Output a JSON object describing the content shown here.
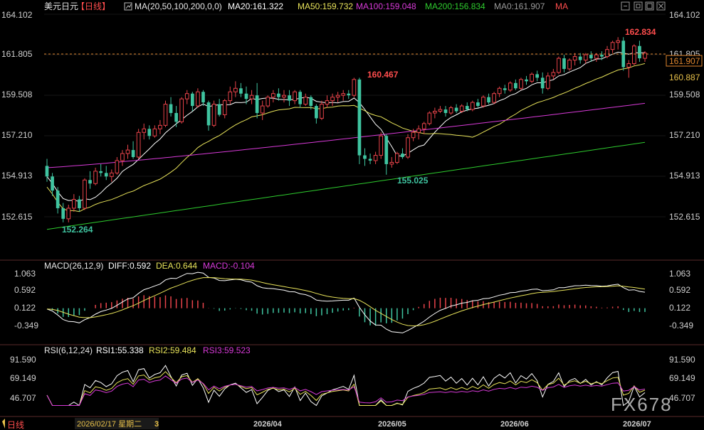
{
  "header": {
    "symbol": "美元日元",
    "period": "【日线】",
    "ma_params": "MA(20,50,100,200,0,0)",
    "ma20": "MA20:161.322",
    "ma50": "MA50:159.732",
    "ma100": "MA100:159.048",
    "ma200": "MA200:156.834",
    "ma0": "MA0:161.907",
    "ma_tag": "MA"
  },
  "macd_header": {
    "params": "MACD(26,12,9)",
    "diff": "DIFF:0.592",
    "dea": "DEA:0.644",
    "macd": "MACD:-0.104"
  },
  "rsi_header": {
    "params": "RSI(6,12,24)",
    "rsi1": "RSI1:55.338",
    "rsi2": "RSI2:59.484",
    "rsi3": "RSI3:59.523"
  },
  "price_axis": {
    "labels_left": [
      "164.102",
      "161.805",
      "159.508",
      "157.210",
      "154.913",
      "152.615"
    ],
    "labels_right": [
      "164.102",
      "161.805",
      "159.508",
      "157.210",
      "154.913",
      "152.615"
    ],
    "values": [
      164.102,
      161.805,
      159.508,
      157.21,
      154.913,
      152.615
    ],
    "current_price": "161.907",
    "low_box": "160.887"
  },
  "annotations": {
    "high1": "160.467",
    "low1": "155.025",
    "low0": "152.264",
    "high2": "162.834"
  },
  "macd_axis": {
    "labels": [
      "1.063",
      "0.592",
      "0.122",
      "-0.349"
    ],
    "values": [
      1.063,
      0.592,
      0.122,
      -0.349
    ]
  },
  "rsi_axis": {
    "labels": [
      "91.590",
      "69.149",
      "46.707"
    ],
    "values": [
      91.59,
      69.149,
      46.707
    ]
  },
  "date_axis": {
    "cursor_date": "2026/02/17 星期二",
    "cursor_tail": "3",
    "ticks": [
      "2026/04",
      "2026/05",
      "2026/06",
      "2026/07"
    ]
  },
  "bottom_tab": "日线",
  "watermark": "FX678",
  "colors": {
    "up": "#e8434a",
    "down": "#3fc4a0",
    "ma20": "#ffffff",
    "ma50": "#e8e35a",
    "ma100": "#d83ad8",
    "ma200": "#2ecc2e",
    "rsi2": "#e8e35a",
    "rsi3": "#d83ad8",
    "label_red": "#ff4d4d",
    "label_green": "#3fc4a0",
    "header_gold": "#e8c14a"
  },
  "chart_data": {
    "type": "candlestick",
    "ohlc": [
      [
        155.5,
        155.9,
        154.6,
        154.9
      ],
      [
        154.9,
        155.1,
        153.8,
        154.1
      ],
      [
        154.1,
        154.3,
        152.8,
        153.1
      ],
      [
        153.1,
        153.4,
        152.3,
        152.5
      ],
      [
        152.5,
        153.3,
        152.3,
        153.1
      ],
      [
        153.1,
        153.9,
        152.9,
        153.6
      ],
      [
        153.6,
        153.8,
        152.9,
        153.1
      ],
      [
        153.1,
        154.8,
        153.0,
        154.7
      ],
      [
        154.7,
        155.2,
        154.2,
        154.5
      ],
      [
        154.5,
        155.4,
        154.4,
        155.2
      ],
      [
        155.2,
        155.6,
        154.9,
        155.1
      ],
      [
        155.1,
        155.5,
        154.7,
        154.9
      ],
      [
        154.9,
        155.3,
        154.6,
        155.1
      ],
      [
        155.1,
        156.0,
        155.0,
        155.8
      ],
      [
        155.8,
        156.4,
        155.5,
        156.2
      ],
      [
        156.2,
        156.7,
        155.9,
        156.4
      ],
      [
        156.4,
        156.9,
        155.9,
        156.0
      ],
      [
        156.0,
        157.6,
        155.9,
        157.4
      ],
      [
        157.4,
        157.9,
        157.0,
        157.6
      ],
      [
        157.6,
        157.8,
        157.0,
        157.2
      ],
      [
        157.2,
        157.8,
        157.1,
        157.6
      ],
      [
        157.6,
        158.1,
        157.3,
        157.8
      ],
      [
        157.8,
        159.2,
        157.7,
        159.0
      ],
      [
        159.0,
        159.4,
        158.3,
        158.5
      ],
      [
        158.5,
        158.9,
        157.7,
        158.0
      ],
      [
        158.0,
        159.4,
        157.9,
        159.3
      ],
      [
        159.3,
        159.8,
        159.0,
        159.6
      ],
      [
        159.6,
        159.7,
        158.6,
        158.9
      ],
      [
        158.9,
        159.9,
        158.8,
        159.7
      ],
      [
        159.7,
        159.8,
        158.9,
        159.1
      ],
      [
        159.1,
        159.2,
        157.5,
        157.8
      ],
      [
        157.8,
        159.2,
        157.7,
        159.0
      ],
      [
        159.0,
        159.3,
        158.3,
        158.4
      ],
      [
        158.4,
        159.3,
        158.2,
        159.2
      ],
      [
        159.2,
        160.0,
        159.0,
        159.7
      ],
      [
        159.7,
        160.3,
        159.4,
        159.9
      ],
      [
        159.9,
        160.2,
        159.4,
        159.6
      ],
      [
        159.6,
        160.0,
        159.0,
        159.3
      ],
      [
        159.3,
        159.8,
        159.0,
        159.5
      ],
      [
        159.5,
        160.2,
        158.2,
        158.5
      ],
      [
        158.5,
        159.2,
        158.1,
        158.9
      ],
      [
        158.9,
        159.5,
        158.8,
        159.4
      ],
      [
        159.4,
        159.8,
        159.1,
        159.6
      ],
      [
        159.6,
        159.9,
        159.2,
        159.4
      ],
      [
        159.4,
        159.8,
        159.1,
        159.5
      ],
      [
        159.5,
        159.8,
        158.9,
        159.2
      ],
      [
        159.2,
        159.8,
        159.0,
        159.7
      ],
      [
        159.7,
        159.8,
        158.8,
        159.0
      ],
      [
        159.0,
        159.6,
        158.9,
        159.4
      ],
      [
        159.4,
        159.5,
        158.7,
        158.9
      ],
      [
        158.9,
        159.0,
        157.9,
        158.2
      ],
      [
        158.2,
        159.2,
        158.1,
        159.0
      ],
      [
        159.0,
        159.5,
        158.8,
        159.2
      ],
      [
        159.2,
        159.6,
        158.9,
        159.4
      ],
      [
        159.4,
        159.7,
        159.1,
        159.5
      ],
      [
        159.5,
        159.8,
        159.2,
        159.6
      ],
      [
        159.6,
        159.8,
        159.3,
        159.5
      ],
      [
        159.5,
        160.5,
        159.4,
        160.4
      ],
      [
        160.4,
        160.5,
        155.6,
        156.1
      ],
      [
        156.1,
        156.5,
        155.5,
        155.9
      ],
      [
        155.9,
        156.2,
        155.6,
        155.8
      ],
      [
        155.8,
        156.3,
        155.6,
        156.1
      ],
      [
        156.1,
        157.4,
        155.9,
        157.2
      ],
      [
        157.2,
        157.3,
        155.0,
        155.6
      ],
      [
        155.6,
        156.0,
        155.4,
        155.7
      ],
      [
        155.7,
        156.3,
        155.6,
        156.2
      ],
      [
        156.2,
        156.5,
        155.9,
        156.0
      ],
      [
        156.0,
        157.3,
        155.9,
        157.1
      ],
      [
        157.1,
        157.6,
        156.9,
        157.4
      ],
      [
        157.4,
        157.8,
        157.0,
        157.6
      ],
      [
        157.6,
        158.0,
        157.3,
        157.9
      ],
      [
        157.9,
        158.6,
        157.8,
        158.5
      ],
      [
        158.5,
        158.8,
        158.2,
        158.6
      ],
      [
        158.6,
        158.9,
        158.5,
        158.7
      ],
      [
        158.7,
        158.9,
        158.3,
        158.5
      ],
      [
        158.5,
        158.9,
        158.4,
        158.8
      ],
      [
        158.8,
        159.0,
        158.5,
        158.6
      ],
      [
        158.6,
        159.0,
        158.5,
        158.9
      ],
      [
        158.9,
        159.1,
        158.6,
        158.7
      ],
      [
        158.7,
        159.2,
        158.6,
        159.1
      ],
      [
        159.1,
        159.3,
        158.8,
        158.9
      ],
      [
        158.9,
        159.5,
        158.8,
        159.4
      ],
      [
        159.4,
        159.6,
        159.0,
        159.1
      ],
      [
        159.1,
        159.7,
        159.0,
        159.6
      ],
      [
        159.6,
        160.0,
        159.4,
        159.9
      ],
      [
        159.9,
        160.1,
        159.6,
        159.8
      ],
      [
        159.8,
        160.3,
        159.7,
        160.2
      ],
      [
        160.2,
        160.4,
        159.8,
        159.9
      ],
      [
        159.9,
        160.5,
        159.8,
        160.4
      ],
      [
        160.4,
        160.6,
        160.1,
        160.3
      ],
      [
        160.3,
        160.8,
        160.2,
        160.7
      ],
      [
        160.7,
        160.9,
        160.3,
        160.5
      ],
      [
        160.5,
        160.8,
        159.6,
        159.9
      ],
      [
        159.9,
        160.8,
        159.8,
        160.6
      ],
      [
        160.6,
        161.0,
        160.4,
        160.8
      ],
      [
        160.8,
        161.7,
        160.7,
        161.6
      ],
      [
        161.6,
        161.8,
        160.8,
        161.0
      ],
      [
        161.0,
        161.6,
        160.9,
        161.5
      ],
      [
        161.5,
        161.9,
        161.2,
        161.7
      ],
      [
        161.7,
        161.9,
        161.3,
        161.5
      ],
      [
        161.5,
        161.9,
        161.3,
        161.8
      ],
      [
        161.8,
        162.0,
        161.4,
        161.6
      ],
      [
        161.6,
        161.9,
        161.4,
        161.8
      ],
      [
        161.8,
        162.0,
        161.5,
        161.7
      ],
      [
        161.7,
        162.3,
        161.6,
        162.1
      ],
      [
        162.1,
        162.6,
        161.9,
        162.5
      ],
      [
        162.5,
        162.8,
        162.1,
        162.6
      ],
      [
        162.6,
        162.8,
        160.9,
        161.1
      ],
      [
        161.1,
        161.5,
        160.5,
        161.3
      ],
      [
        161.3,
        162.4,
        161.2,
        162.3
      ],
      [
        162.3,
        162.6,
        161.4,
        161.6
      ],
      [
        161.6,
        162.0,
        161.4,
        161.9
      ]
    ],
    "ma20_last": 161.322,
    "ma50_last": 159.732,
    "ma100_last": 159.048,
    "ma200_last": 156.834,
    "x_ticks": [
      "2026/04",
      "2026/05",
      "2026/06",
      "2026/07"
    ]
  }
}
